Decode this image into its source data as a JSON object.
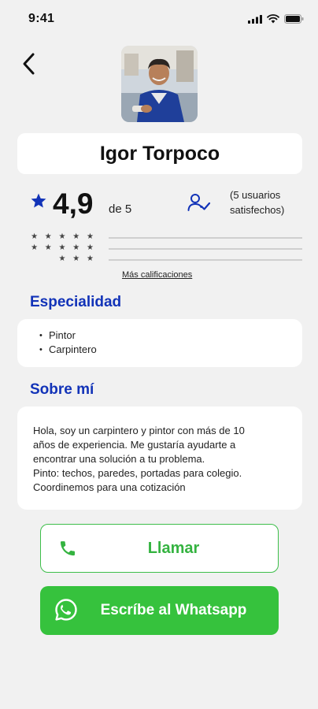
{
  "status_bar": {
    "time": "9:41"
  },
  "profile": {
    "name": "Igor Torpoco"
  },
  "rating": {
    "value": "4,9",
    "scale": "de 5",
    "users_line1": "(5 usuarios",
    "users_line2": "satisfechos)",
    "distribution_stars": [
      "★ ★ ★ ★ ★",
      "★ ★ ★ ★ ★",
      "★ ★ ★"
    ],
    "more_link": "Más calificaciones"
  },
  "specialty": {
    "title": "Especialidad",
    "items": [
      "Pintor",
      "Carpintero"
    ]
  },
  "about": {
    "title": "Sobre mí",
    "lines": [
      "Hola, soy un carpintero y pintor con más de 10",
      "años de experiencia. Me gustaría ayudarte a",
      "encontrar una solución a tu problema.",
      "Pinto: techos, paredes, portadas para colegio.",
      "Coordinemos para una cotización"
    ]
  },
  "actions": {
    "call_label": "Llamar",
    "whatsapp_label": "Escríbe al Whatsapp"
  },
  "colors": {
    "accent_blue": "#1233b8",
    "green": "#36c23d",
    "background": "#f1f1f1"
  },
  "icons": [
    "back-chevron-icon",
    "star-icon",
    "users-check-icon",
    "phone-icon",
    "whatsapp-icon",
    "signal-icon",
    "wifi-icon",
    "battery-icon"
  ]
}
